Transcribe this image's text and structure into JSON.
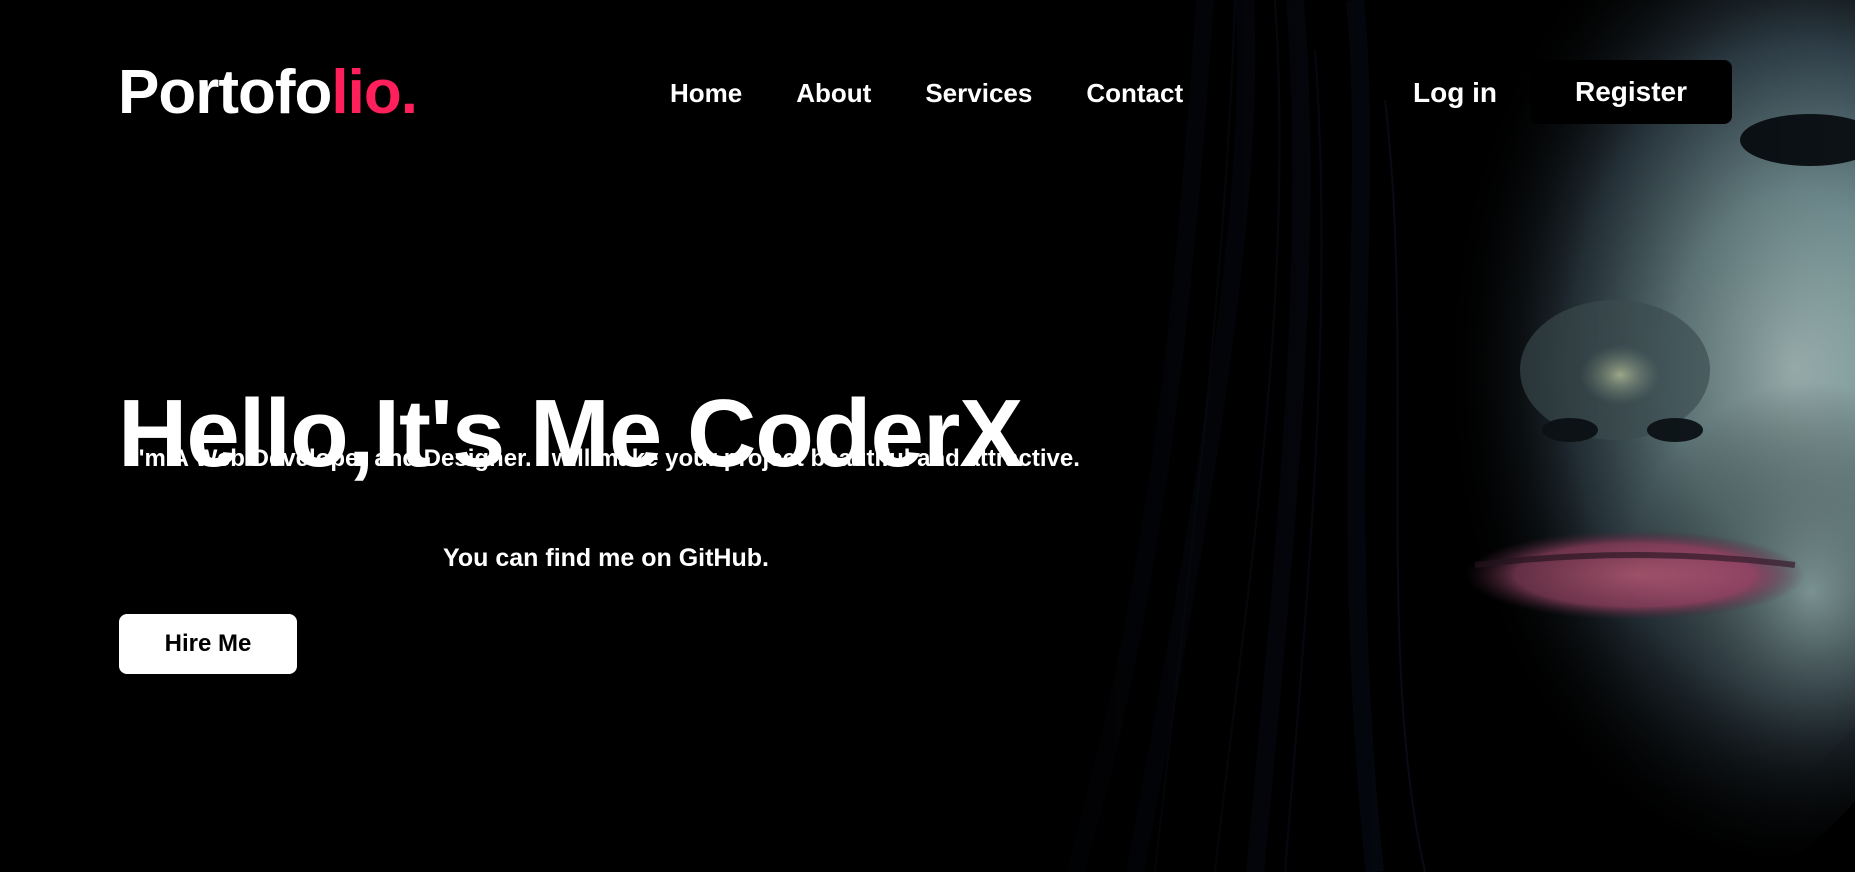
{
  "brand": {
    "logo_main": "Portofo",
    "logo_accent": "lio.",
    "accent_color": "#ff1f5a"
  },
  "nav": {
    "items": [
      {
        "label": "Home"
      },
      {
        "label": "About"
      },
      {
        "label": "Services"
      },
      {
        "label": "Contact"
      }
    ]
  },
  "auth": {
    "login_label": "Log in",
    "register_label": "Register"
  },
  "hero": {
    "title": "Hello,It's Me CoderX",
    "description": "I'm A Web Developer and Designer. I will make your project beautiful and attractive.",
    "github_line": "You can find me on GitHub.",
    "cta_label": "Hire Me"
  }
}
